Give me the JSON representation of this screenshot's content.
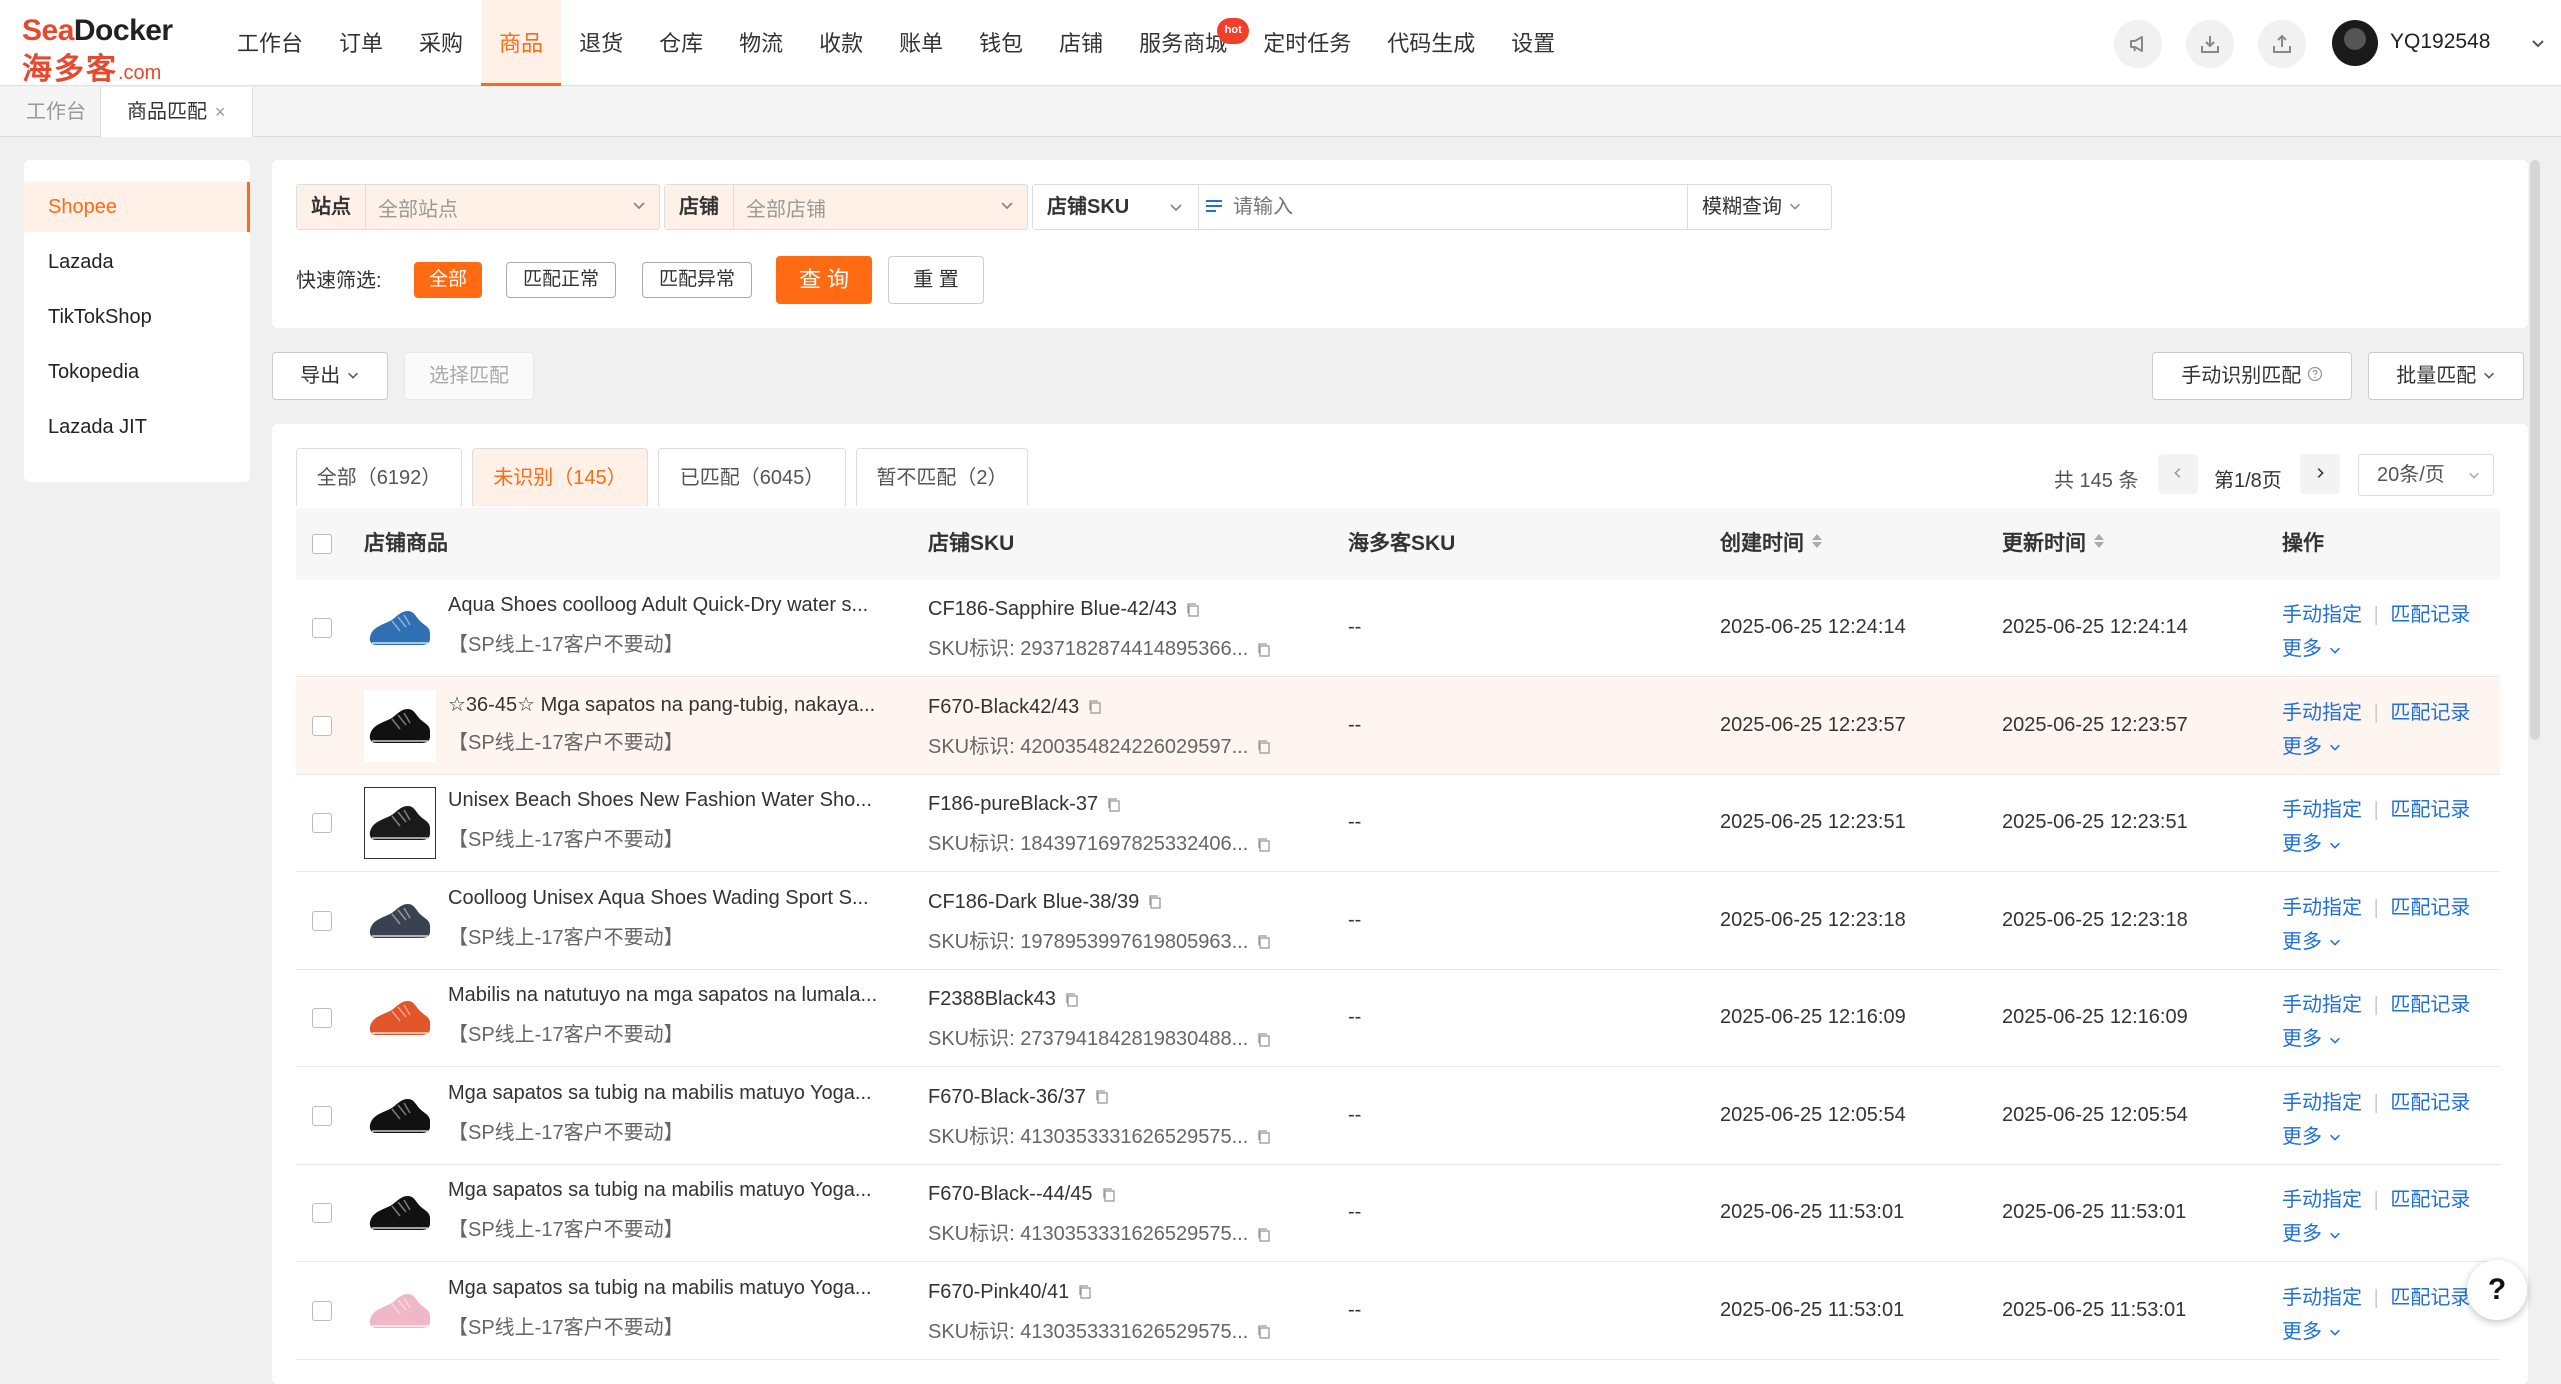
{
  "app": {
    "logo_top_a": "Sea",
    "logo_top_b": "Docker",
    "logo_bottom": "海多客",
    "logo_suffix": ".com",
    "accent": "#ff6a13",
    "link_color": "#1e6fe0"
  },
  "nav": {
    "items": [
      "工作台",
      "订单",
      "采购",
      "商品",
      "退货",
      "仓库",
      "物流",
      "收款",
      "账单",
      "钱包",
      "店铺",
      "服务商城",
      "定时任务",
      "代码生成",
      "设置"
    ],
    "active": "商品",
    "hot_badge": "hot"
  },
  "user": {
    "name": "YQ192548"
  },
  "page_tabs": [
    {
      "label": "工作台"
    },
    {
      "label": "商品匹配",
      "close": "×"
    }
  ],
  "sidebar": {
    "items": [
      "Shopee",
      "Lazada",
      "TikTokShop",
      "Tokopedia",
      "Lazada JIT"
    ],
    "active": "Shopee"
  },
  "filters": {
    "site": {
      "label": "站点",
      "value": "全部站点"
    },
    "shop": {
      "label": "店铺",
      "value": "全部店铺"
    },
    "sku": {
      "label": "店铺SKU",
      "placeholder": "请输入",
      "mode": "模糊查询"
    },
    "quick_label": "快速筛选:",
    "quick_chips": [
      "全部",
      "匹配正常",
      "匹配异常"
    ],
    "query_btn": "查 询",
    "reset_btn": "重 置"
  },
  "toolbar": {
    "export": "导出",
    "select_match": "选择匹配",
    "manual_identify": "手动识别匹配",
    "bulk_match": "批量匹配"
  },
  "status_tabs": [
    "全部（6192）",
    "未识别（145）",
    "已匹配（6045）",
    "暂不匹配（2）"
  ],
  "pagination": {
    "total": "共 145 条",
    "page": "第1/8页",
    "size": "20条/页"
  },
  "table": {
    "headers": {
      "product": "店铺商品",
      "shop_sku": "店铺SKU",
      "hdk_sku": "海多客SKU",
      "created": "创建时间",
      "updated": "更新时间",
      "actions": "操作"
    },
    "action_labels": {
      "assign": "手动指定",
      "sep": "|",
      "record": "匹配记录",
      "more": "更多"
    },
    "sku_id_label": "SKU标识:",
    "rows": [
      {
        "title": "Aqua Shoes coolloog Adult Quick-Dry water s...",
        "shop": "【SP线上-17客户不要动】",
        "sku": "CF186-Sapphire Blue-42/43",
        "sku_id": "2937182874414895366...",
        "hdk": "--",
        "created": "2025-06-25 12:24:14",
        "updated": "2025-06-25 12:24:14",
        "thumb_color": "#2f6fb3"
      },
      {
        "title": "☆36-45☆ Mga sapatos na pang-tubig, nakaya...",
        "shop": "【SP线上-17客户不要动】",
        "sku": "F670-Black42/43",
        "sku_id": "4200354824226029597...",
        "hdk": "--",
        "created": "2025-06-25 12:23:57",
        "updated": "2025-06-25 12:23:57",
        "thumb_color": "#111111"
      },
      {
        "title": "Unisex Beach Shoes New Fashion Water Sho...",
        "shop": "【SP线上-17客户不要动】",
        "sku": "F186-pureBlack-37",
        "sku_id": "1843971697825332406...",
        "hdk": "--",
        "created": "2025-06-25 12:23:51",
        "updated": "2025-06-25 12:23:51",
        "thumb_color": "#1a1a1a"
      },
      {
        "title": "Coolloog Unisex Aqua Shoes Wading Sport S...",
        "shop": "【SP线上-17客户不要动】",
        "sku": "CF186-Dark Blue-38/39",
        "sku_id": "1978953997619805963...",
        "hdk": "--",
        "created": "2025-06-25 12:23:18",
        "updated": "2025-06-25 12:23:18",
        "thumb_color": "#3a4150"
      },
      {
        "title": "Mabilis na natutuyo na mga sapatos na lumala...",
        "shop": "【SP线上-17客户不要动】",
        "sku": "F2388Black43",
        "sku_id": "2737941842819830488...",
        "hdk": "--",
        "created": "2025-06-25 12:16:09",
        "updated": "2025-06-25 12:16:09",
        "thumb_color": "#e0552a"
      },
      {
        "title": "Mga sapatos sa tubig na mabilis matuyo Yoga...",
        "shop": "【SP线上-17客户不要动】",
        "sku": "F670-Black-36/37",
        "sku_id": "4130353331626529575...",
        "hdk": "--",
        "created": "2025-06-25 12:05:54",
        "updated": "2025-06-25 12:05:54",
        "thumb_color": "#111111"
      },
      {
        "title": "Mga sapatos sa tubig na mabilis matuyo Yoga...",
        "shop": "【SP线上-17客户不要动】",
        "sku": "F670-Black--44/45",
        "sku_id": "4130353331626529575...",
        "hdk": "--",
        "created": "2025-06-25 11:53:01",
        "updated": "2025-06-25 11:53:01",
        "thumb_color": "#111111"
      },
      {
        "title": "Mga sapatos sa tubig na mabilis matuyo Yoga...",
        "shop": "【SP线上-17客户不要动】",
        "sku": "F670-Pink40/41",
        "sku_id": "4130353331626529575...",
        "hdk": "--",
        "created": "2025-06-25 11:53:01",
        "updated": "2025-06-25 11:53:01",
        "thumb_color": "#f0b7c8"
      }
    ]
  },
  "help": "?"
}
